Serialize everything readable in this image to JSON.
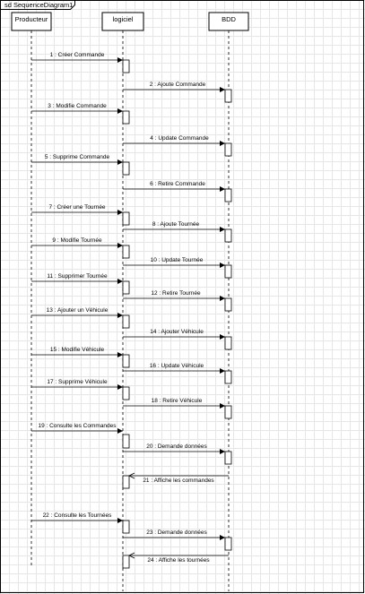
{
  "frame": {
    "title": "sd SequenceDiagram1"
  },
  "lifelines": [
    {
      "id": "producteur",
      "name": "Producteur"
    },
    {
      "id": "logiciel",
      "name": "logiciel"
    },
    {
      "id": "bdd",
      "name": "BDD"
    }
  ],
  "messages": [
    {
      "label": "1 : Créer Commande",
      "from": "producteur",
      "to": "logiciel",
      "kind": "call"
    },
    {
      "label": "2 : Ajoute Commande",
      "from": "logiciel",
      "to": "bdd",
      "kind": "call"
    },
    {
      "label": "3 : Modifie Commande",
      "from": "producteur",
      "to": "logiciel",
      "kind": "call"
    },
    {
      "label": "4 : Update Commande",
      "from": "logiciel",
      "to": "bdd",
      "kind": "call"
    },
    {
      "label": "5 : Supprime Commande",
      "from": "producteur",
      "to": "logiciel",
      "kind": "call"
    },
    {
      "label": "6 : Retire Commande",
      "from": "logiciel",
      "to": "bdd",
      "kind": "call"
    },
    {
      "label": "7 : Créer une Tournée",
      "from": "producteur",
      "to": "logiciel",
      "kind": "call"
    },
    {
      "label": "8 : Ajoute Tournée",
      "from": "logiciel",
      "to": "bdd",
      "kind": "call"
    },
    {
      "label": "9 : Modifie Tournée",
      "from": "producteur",
      "to": "logiciel",
      "kind": "call"
    },
    {
      "label": "10 : Update Tournée",
      "from": "logiciel",
      "to": "bdd",
      "kind": "call"
    },
    {
      "label": "11 : Supprimer Tournée",
      "from": "producteur",
      "to": "logiciel",
      "kind": "call"
    },
    {
      "label": "12 : Retire Tournée",
      "from": "logiciel",
      "to": "bdd",
      "kind": "call"
    },
    {
      "label": "13 : Ajouter un Véhicule",
      "from": "producteur",
      "to": "logiciel",
      "kind": "call"
    },
    {
      "label": "14 : Ajouter Véhicule",
      "from": "logiciel",
      "to": "bdd",
      "kind": "call"
    },
    {
      "label": "15 : Modifie Véhicule",
      "from": "producteur",
      "to": "logiciel",
      "kind": "call"
    },
    {
      "label": "16 : Update Véhicule",
      "from": "logiciel",
      "to": "bdd",
      "kind": "call"
    },
    {
      "label": "17 : Supprime Véhicule",
      "from": "producteur",
      "to": "logiciel",
      "kind": "call"
    },
    {
      "label": "18 : Retire Véhicule",
      "from": "logiciel",
      "to": "bdd",
      "kind": "call"
    },
    {
      "label": "19 : Consulte les Commandes",
      "from": "producteur",
      "to": "logiciel",
      "kind": "call"
    },
    {
      "label": "20 : Demande données",
      "from": "logiciel",
      "to": "bdd",
      "kind": "call"
    },
    {
      "label": "21 : Affiche les commandes",
      "from": "bdd",
      "to": "logiciel",
      "kind": "return"
    },
    {
      "label": "22 : Consulte les Tournées",
      "from": "producteur",
      "to": "logiciel",
      "kind": "call"
    },
    {
      "label": "23 : Demande données",
      "from": "logiciel",
      "to": "bdd",
      "kind": "call"
    },
    {
      "label": "24 : Affiche les tournées",
      "from": "bdd",
      "to": "logiciel",
      "kind": "return"
    }
  ],
  "colors": {
    "line": "#000000",
    "grid": "#e6e6e6",
    "background": "#ffffff",
    "box_fill": "#ffffff"
  }
}
